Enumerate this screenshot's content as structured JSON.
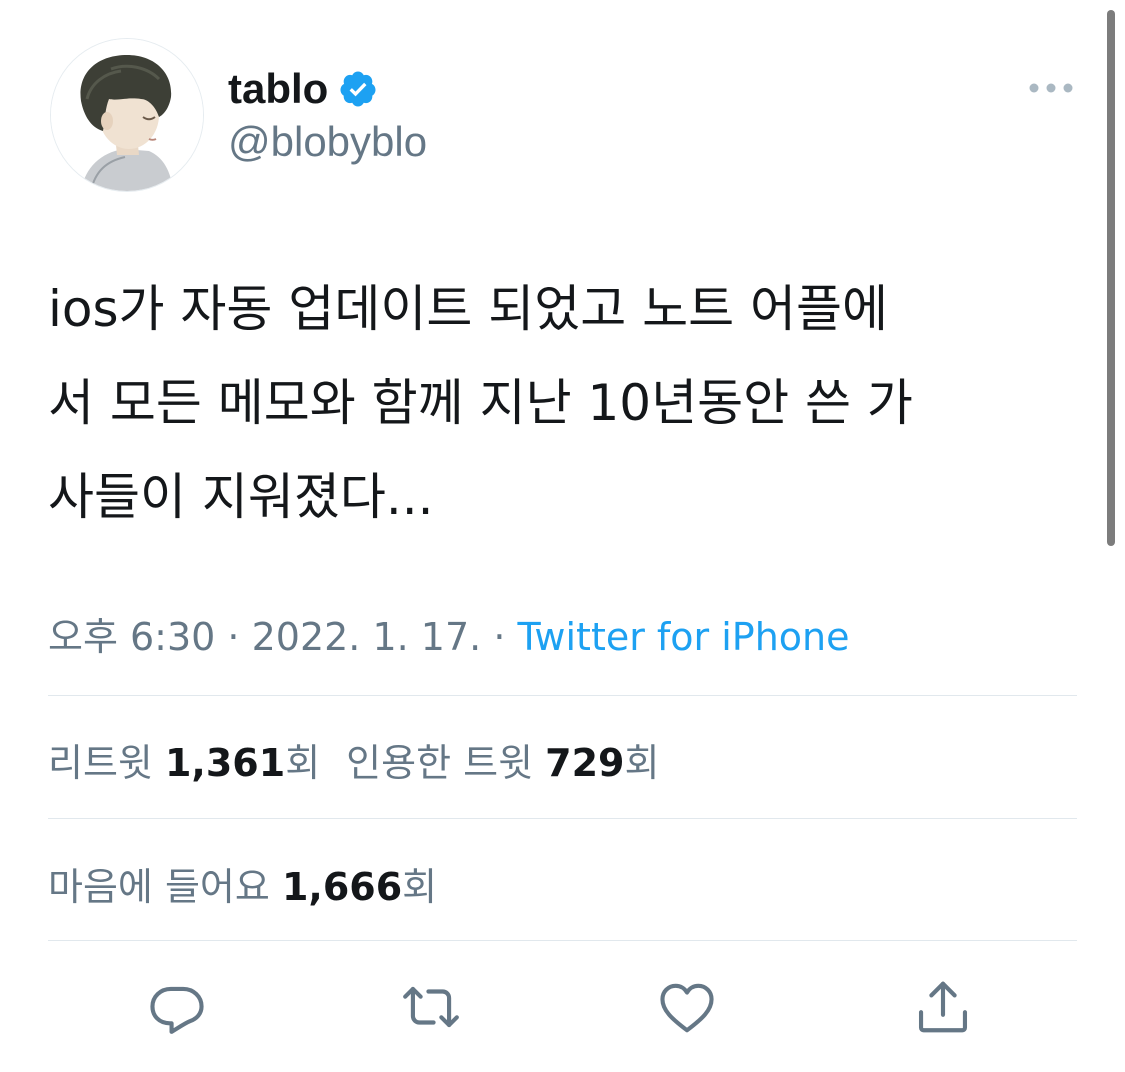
{
  "user": {
    "display_name": "tablo",
    "handle": "@blobyblo",
    "verified": true,
    "avatar": "avatar-illustration"
  },
  "tweet": {
    "text": "ios가 자동 업데이트 되었고 노트 어플에\n서 모든 메모와 함께 지난 10년동안 쓴 가\n사들이 지워졌다..."
  },
  "meta": {
    "time": "오후 6:30",
    "separator": " · ",
    "date": "2022. 1. 17.",
    "source": "Twitter for iPhone"
  },
  "stats": {
    "retweets_label": "리트윗",
    "retweets_count": "1,361",
    "retweets_unit": "회",
    "quotes_label": "인용한 트윗",
    "quotes_count": "729",
    "quotes_unit": "회",
    "likes_label": "마음에 들어요",
    "likes_count": "1,666",
    "likes_unit": "회"
  },
  "actions": [
    {
      "icon": "reply-icon"
    },
    {
      "icon": "retweet-icon"
    },
    {
      "icon": "like-icon"
    },
    {
      "icon": "share-icon"
    }
  ],
  "colors": {
    "text": "#14171a",
    "secondary": "#657786",
    "link": "#1da1f2",
    "verified": "#1da1f2",
    "divider": "#e1e8ed"
  }
}
